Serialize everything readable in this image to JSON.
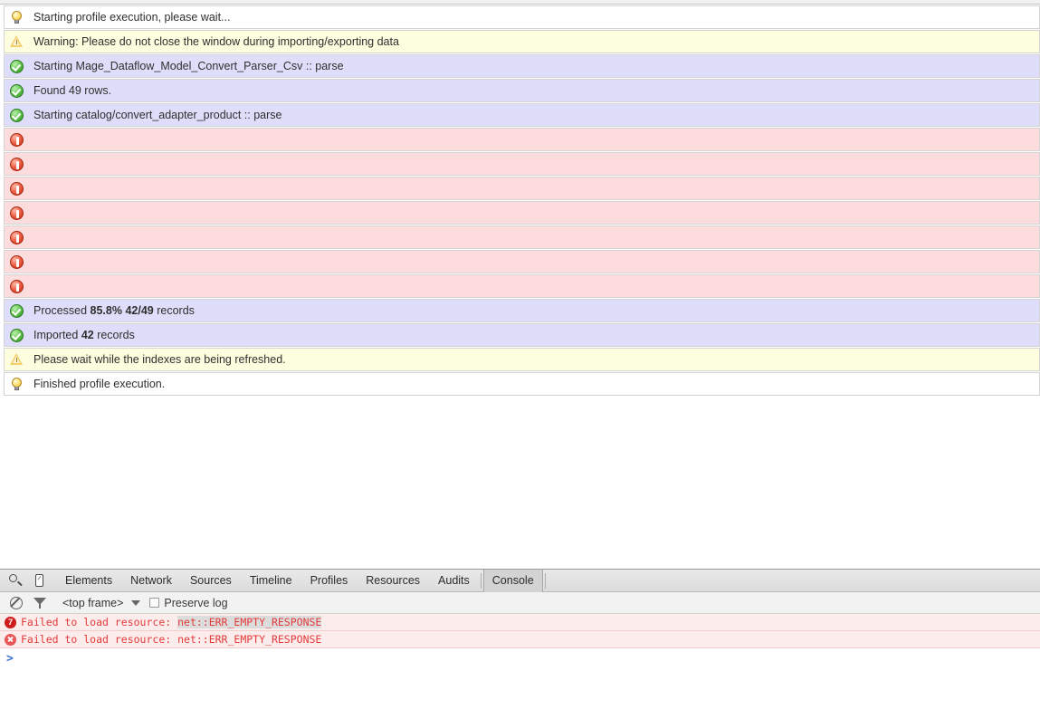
{
  "profile_log": {
    "rows": [
      {
        "type": "notice",
        "icon": "lightbulb-icon",
        "text": "Starting profile execution, please wait..."
      },
      {
        "type": "warning",
        "icon": "warning-triangle-icon",
        "text": "Warning: Please do not close the window during importing/exporting data"
      },
      {
        "type": "success",
        "icon": "check-circle-icon",
        "text": "Starting Mage_Dataflow_Model_Convert_Parser_Csv :: parse"
      },
      {
        "type": "success",
        "icon": "check-circle-icon",
        "text": "Found 49 rows."
      },
      {
        "type": "success",
        "icon": "check-circle-icon",
        "text": "Starting catalog/convert_adapter_product :: parse"
      },
      {
        "type": "error",
        "icon": "error-circle-icon",
        "text": ""
      },
      {
        "type": "error",
        "icon": "error-circle-icon",
        "text": ""
      },
      {
        "type": "error",
        "icon": "error-circle-icon",
        "text": ""
      },
      {
        "type": "error",
        "icon": "error-circle-icon",
        "text": ""
      },
      {
        "type": "error",
        "icon": "error-circle-icon",
        "text": ""
      },
      {
        "type": "error",
        "icon": "error-circle-icon",
        "text": ""
      },
      {
        "type": "error",
        "icon": "error-circle-icon",
        "text": ""
      },
      {
        "type": "success",
        "icon": "check-circle-icon",
        "text": "Processed 85.8% 42/49 records",
        "html": "Processed <b>85.8%</b> <b>42/49</b> records"
      },
      {
        "type": "success",
        "icon": "check-circle-icon",
        "text": "Imported 42 records",
        "html": "Imported <b>42</b> records"
      },
      {
        "type": "warning",
        "icon": "warning-triangle-icon",
        "text": "Please wait while the indexes are being refreshed."
      },
      {
        "type": "notice",
        "icon": "lightbulb-icon",
        "text": "Finished profile execution."
      }
    ],
    "colors": {
      "notice_bg": "#ffffff",
      "warning_bg": "#fdfddf",
      "success_bg": "#dedefa",
      "error_bg": "#fcdcdc",
      "row_border": "#d4d4d4"
    }
  },
  "devtools": {
    "tabs": [
      {
        "label": "Elements",
        "active": false
      },
      {
        "label": "Network",
        "active": false
      },
      {
        "label": "Sources",
        "active": false
      },
      {
        "label": "Timeline",
        "active": false
      },
      {
        "label": "Profiles",
        "active": false
      },
      {
        "label": "Resources",
        "active": false
      },
      {
        "label": "Audits",
        "active": false
      },
      {
        "label": "Console",
        "active": true
      }
    ],
    "toolbar_icons": [
      {
        "name": "search-icon"
      },
      {
        "name": "device-toggle-icon"
      }
    ],
    "subbar": {
      "clear_icon": "clear-console-icon",
      "filter_icon": "filter-icon",
      "frame_selector_value": "<top frame>",
      "frame_selector_caret": "chevron-down-icon",
      "preserve_log_label": "Preserve log",
      "preserve_log_checked": false
    },
    "console_messages": [
      {
        "badge_type": "count",
        "badge_value": "7",
        "prefix": "Failed to load resource: ",
        "highlight": "net::ERR_EMPTY_RESPONSE",
        "highlighted": true
      },
      {
        "badge_type": "error-x",
        "badge_value": "",
        "prefix": "Failed to load resource: ",
        "highlight": "net::ERR_EMPTY_RESPONSE",
        "highlighted": false
      }
    ],
    "prompt_symbol": ">",
    "colors": {
      "error_row_bg": "#fdecec",
      "error_text": "#e33a3a",
      "badge_count_bg": "#cf1b1b",
      "tabbar_bg": "#e3e3e3",
      "active_tab_bg": "#d3d3d3",
      "prompt_color": "#3b6fd4"
    }
  }
}
